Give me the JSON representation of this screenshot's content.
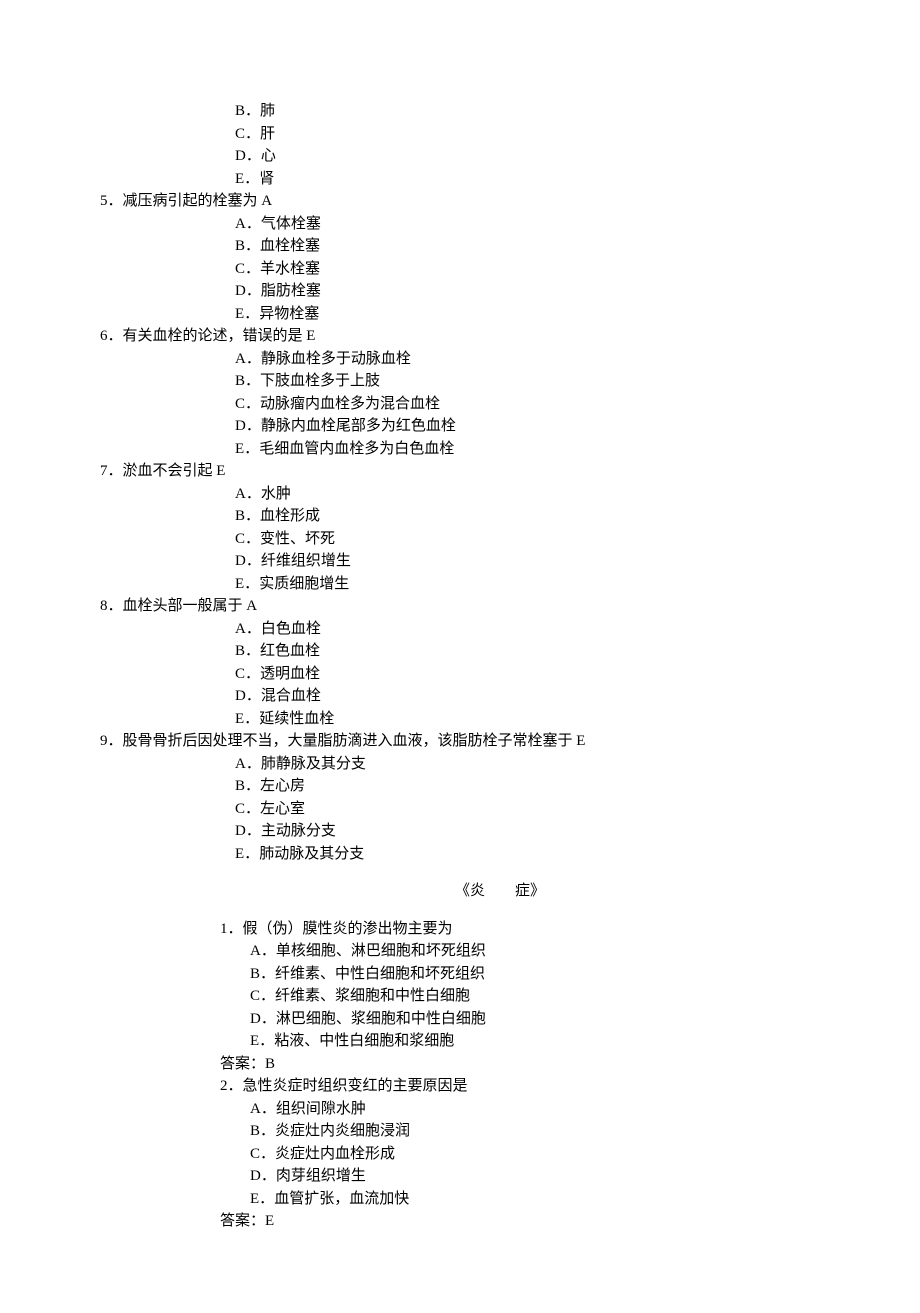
{
  "section1": {
    "q4_tail_options": [
      {
        "letter": "B",
        "text": "肺"
      },
      {
        "letter": "C",
        "text": "肝"
      },
      {
        "letter": "D",
        "text": "心"
      },
      {
        "letter": "E",
        "text": "肾"
      }
    ],
    "questions": [
      {
        "num": "5",
        "text": "减压病引起的栓塞为 A",
        "options": [
          {
            "letter": "A",
            "text": "气体栓塞"
          },
          {
            "letter": "B",
            "text": "血栓栓塞"
          },
          {
            "letter": "C",
            "text": "羊水栓塞"
          },
          {
            "letter": "D",
            "text": "脂肪栓塞"
          },
          {
            "letter": "E",
            "text": "异物栓塞"
          }
        ]
      },
      {
        "num": "6",
        "text": "有关血栓的论述，错误的是 E",
        "options": [
          {
            "letter": "A",
            "text": "静脉血栓多于动脉血栓"
          },
          {
            "letter": "B",
            "text": "下肢血栓多于上肢"
          },
          {
            "letter": "C",
            "text": "动脉瘤内血栓多为混合血栓"
          },
          {
            "letter": "D",
            "text": "静脉内血栓尾部多为红色血栓"
          },
          {
            "letter": "E",
            "text": "毛细血管内血栓多为白色血栓"
          }
        ]
      },
      {
        "num": "7",
        "text": "淤血不会引起 E",
        "options": [
          {
            "letter": "A",
            "text": "水肿"
          },
          {
            "letter": "B",
            "text": "血栓形成"
          },
          {
            "letter": "C",
            "text": "变性、坏死"
          },
          {
            "letter": "D",
            "text": "纤维组织增生"
          },
          {
            "letter": "E",
            "text": "实质细胞增生"
          }
        ]
      },
      {
        "num": "8",
        "text": "血栓头部一般属于 A",
        "options": [
          {
            "letter": "A",
            "text": "白色血栓"
          },
          {
            "letter": "B",
            "text": "红色血栓"
          },
          {
            "letter": "C",
            "text": "透明血栓"
          },
          {
            "letter": "D",
            "text": "混合血栓"
          },
          {
            "letter": "E",
            "text": "延续性血栓"
          }
        ]
      },
      {
        "num": "9",
        "text": "股骨骨折后因处理不当，大量脂肪滴进入血液，该脂肪栓子常栓塞于 E",
        "options": [
          {
            "letter": "A",
            "text": "肺静脉及其分支"
          },
          {
            "letter": "B",
            "text": "左心房"
          },
          {
            "letter": "C",
            "text": "左心室"
          },
          {
            "letter": "D",
            "text": "主动脉分支"
          },
          {
            "letter": "E",
            "text": "肺动脉及其分支"
          }
        ]
      }
    ]
  },
  "section2": {
    "title": "《炎　　症》",
    "questions": [
      {
        "num": "1",
        "text": "假（伪）膜性炎的渗出物主要为",
        "options": [
          {
            "letter": "A",
            "text": "单核细胞、淋巴细胞和坏死组织"
          },
          {
            "letter": "B",
            "text": "纤维素、中性白细胞和坏死组织"
          },
          {
            "letter": "C",
            "text": "纤维素、浆细胞和中性白细胞"
          },
          {
            "letter": "D",
            "text": "淋巴细胞、浆细胞和中性白细胞"
          },
          {
            "letter": "E",
            "text": "粘液、中性白细胞和浆细胞"
          }
        ],
        "answer_label": "答案：",
        "answer": "B"
      },
      {
        "num": "2",
        "text": "急性炎症时组织变红的主要原因是",
        "options": [
          {
            "letter": "A",
            "text": "组织间隙水肿"
          },
          {
            "letter": "B",
            "text": "炎症灶内炎细胞浸润"
          },
          {
            "letter": "C",
            "text": "炎症灶内血栓形成"
          },
          {
            "letter": "D",
            "text": "肉芽组织增生"
          },
          {
            "letter": "E",
            "text": "血管扩张，血流加快"
          }
        ],
        "answer_label": "答案：",
        "answer": "E"
      }
    ]
  }
}
